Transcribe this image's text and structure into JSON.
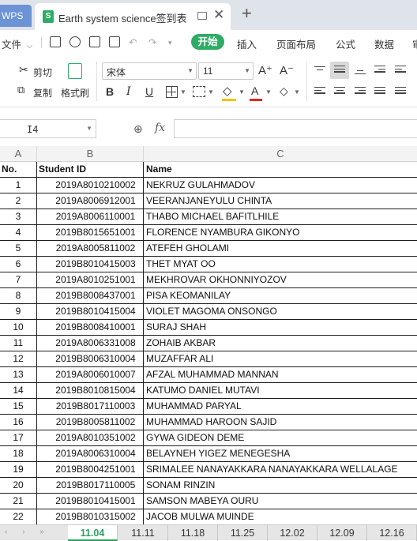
{
  "tabs": {
    "app_label": "WPS",
    "doc_title": "Earth system science签到表",
    "doc_icon_letter": "S",
    "close_glyph": "✕",
    "new_tab_glyph": "+"
  },
  "menu": {
    "file_label": "文件",
    "file_arrow": "⌵",
    "start_label": "开始",
    "insert_label": "插入",
    "page_layout_label": "页面布局",
    "formula_label": "公式",
    "data_label": "数据",
    "truncated_label": "审"
  },
  "ribbon": {
    "cut_label": "剪切",
    "copy_label": "复制",
    "format_painter_label": "格式刷",
    "font_name": "宋体",
    "font_size": "11",
    "bold": "B",
    "italic": "I",
    "underline": "U",
    "grow_font": "A⁺",
    "shrink_font": "A⁻",
    "font_color_letter": "A",
    "font_color": "#e02424",
    "fill_color": "#f2c40f"
  },
  "formula_bar": {
    "cell_ref": "I4",
    "fx_label": "fx",
    "value": ""
  },
  "grid": {
    "columns": [
      "A",
      "B",
      "C"
    ],
    "header": {
      "no": "No.",
      "student_id": "Student ID",
      "name": "Name"
    },
    "rows": [
      {
        "no": "1",
        "id": "2019A8010210002",
        "name": "NEKRUZ GULAHMADOV"
      },
      {
        "no": "2",
        "id": "2019A8006912001",
        "name": "VEERANJANEYULU CHINTA"
      },
      {
        "no": "3",
        "id": "2019A8006110001",
        "name": "THABO MICHAEL BAFITLHILE"
      },
      {
        "no": "4",
        "id": "2019B8015651001",
        "name": "FLORENCE NYAMBURA GIKONYO"
      },
      {
        "no": "5",
        "id": "2019A8005811002",
        "name": "ATEFEH GHOLAMI"
      },
      {
        "no": "6",
        "id": "2019B8010415003",
        "name": "THET MYAT OO"
      },
      {
        "no": "7",
        "id": "2019A8010251001",
        "name": "MEKHROVAR OKHONNIYOZOV"
      },
      {
        "no": "8",
        "id": "2019B8008437001",
        "name": "PISA KEOMANILAY"
      },
      {
        "no": "9",
        "id": "2019B8010415004",
        "name": "VIOLET MAGOMA ONSONGO"
      },
      {
        "no": "10",
        "id": "2019B8008410001",
        "name": "SURAJ SHAH"
      },
      {
        "no": "11",
        "id": "2019A8006331008",
        "name": "ZOHAIB AKBAR"
      },
      {
        "no": "12",
        "id": "2019B8006310004",
        "name": "MUZAFFAR ALI"
      },
      {
        "no": "13",
        "id": "2019A8006010007",
        "name": "AFZAL MUHAMMAD MANNAN"
      },
      {
        "no": "14",
        "id": "2019B8010815004",
        "name": "KATUMO DANIEL MUTAVI"
      },
      {
        "no": "15",
        "id": "2019B8017110003",
        "name": "MUHAMMAD PARYAL"
      },
      {
        "no": "16",
        "id": "2019B8005811002",
        "name": "MUHAMMAD HAROON SAJID"
      },
      {
        "no": "17",
        "id": "2019A8010351002",
        "name": "GYWA GIDEON DEME"
      },
      {
        "no": "18",
        "id": "2019A8006310004",
        "name": "BELAYNEH YIGEZ MENEGESHA"
      },
      {
        "no": "19",
        "id": "2019B8004251001",
        "name": "SRIMALEE NANAYAKKARA NANAYAKKARA WELLALAGE"
      },
      {
        "no": "20",
        "id": "2019B8017110005",
        "name": "SONAM RINZIN"
      },
      {
        "no": "21",
        "id": "2019B8010415001",
        "name": "SAMSON MABEYA OURU"
      },
      {
        "no": "22",
        "id": "2019B8010315002",
        "name": "JACOB MULWA MUINDE"
      }
    ]
  },
  "sheets": {
    "nav": "‹ › »",
    "tabs": [
      "11.04",
      "11.11",
      "11.18",
      "11.25",
      "12.02",
      "12.09",
      "12.16"
    ],
    "active": "11.04"
  },
  "colors": {
    "accent_green": "#2eac66",
    "tab_active_text": "#2aa25c"
  }
}
